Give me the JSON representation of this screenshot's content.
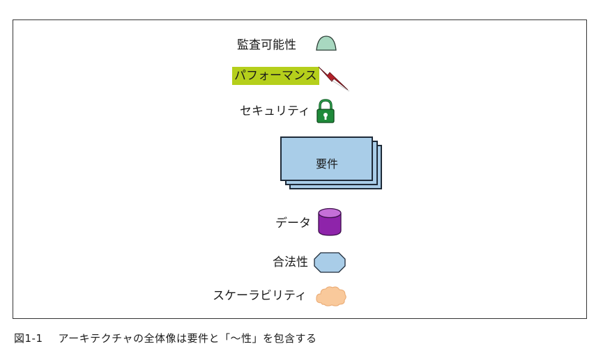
{
  "figure": {
    "items": {
      "auditability": "監査可能性",
      "performance": "パフォーマンス",
      "security": "セキュリティ",
      "requirements": "要件",
      "data": "データ",
      "legality": "合法性",
      "scalability": "スケーラビリティ"
    },
    "colors": {
      "auditability_icon": "#a8d8c0",
      "performance_highlight": "#b5cf1b",
      "performance_icon": "#b1202a",
      "security_icon": "#1f8a3a",
      "requirements_card": "#a9cde8",
      "data_icon": "#8e24aa",
      "legality_icon": "#a9cde8",
      "scalability_icon": "#f9c99b"
    },
    "icons": {
      "auditability": "dome-icon",
      "performance": "lightning-bolt-icon",
      "security": "padlock-icon",
      "requirements": "stacked-cards",
      "data": "cylinder-icon",
      "legality": "octagon-icon",
      "scalability": "cloud-icon"
    }
  },
  "caption": {
    "number": "図1-1",
    "text": "アーキテクチャの全体像は要件と「〜性」を包含する"
  }
}
